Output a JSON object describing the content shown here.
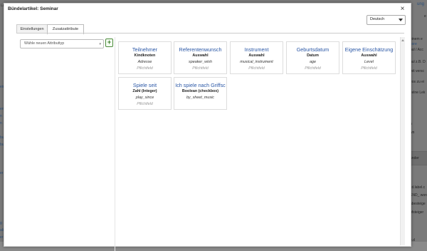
{
  "modal": {
    "title": "Bündelartikel: Seminar",
    "close_symbol": "×",
    "language": "Deutsch",
    "tabs": [
      {
        "label": "Einstellungen",
        "active": false
      },
      {
        "label": "Zusatzattribute",
        "active": true
      }
    ],
    "attribute_select_placeholder": "Wähle neuen Attributtyp",
    "add_symbol": "+",
    "cards": [
      {
        "title": "Teilnehmer",
        "type": "Kindknoten",
        "key": "Adresse",
        "required": "Pflichtfeld"
      },
      {
        "title": "Referentenwunsch",
        "type": "Auswahl",
        "key": "speaker_wish",
        "required": "Pflichtfeld"
      },
      {
        "title": "Instrument",
        "type": "Auswahl",
        "key": "musical_instrument",
        "required": "Pflichtfeld"
      },
      {
        "title": "Geburtsdatum",
        "type": "Datum",
        "key": "age",
        "required": "Pflichtfeld"
      },
      {
        "title": "Eigene Einschätzung",
        "type": "Auswahl",
        "key": "Level",
        "required": "Pflichtfeld"
      },
      {
        "title": "Spiele seit",
        "type": "Zahl (Integer)",
        "key": "play_since",
        "required": "Pflichtfeld"
      },
      {
        "title": "Ich spiele nach Griffsc",
        "type": "Boolean (checkbox)",
        "key": "by_sheet_music",
        "required": ""
      }
    ]
  },
  "background": {
    "left": [
      "Lagerort",
      "eim",
      "en",
      "n",
      "n",
      "burg",
      "burg",
      "er Hü",
      "g",
      "alist",
      "er"
    ],
    "right": [
      "ung",
      "e",
      "einem e",
      "sore",
      "hul / Acc",
      "hul z.B. D",
      "mit versc",
      "eos zu ei",
      "zelne Lek",
      "n",
      "wn",
      "änder",
      "cd.label.c",
      "END_ won",
      "abesteige",
      "ufsteiger",
      ")",
      "e.d"
    ]
  }
}
